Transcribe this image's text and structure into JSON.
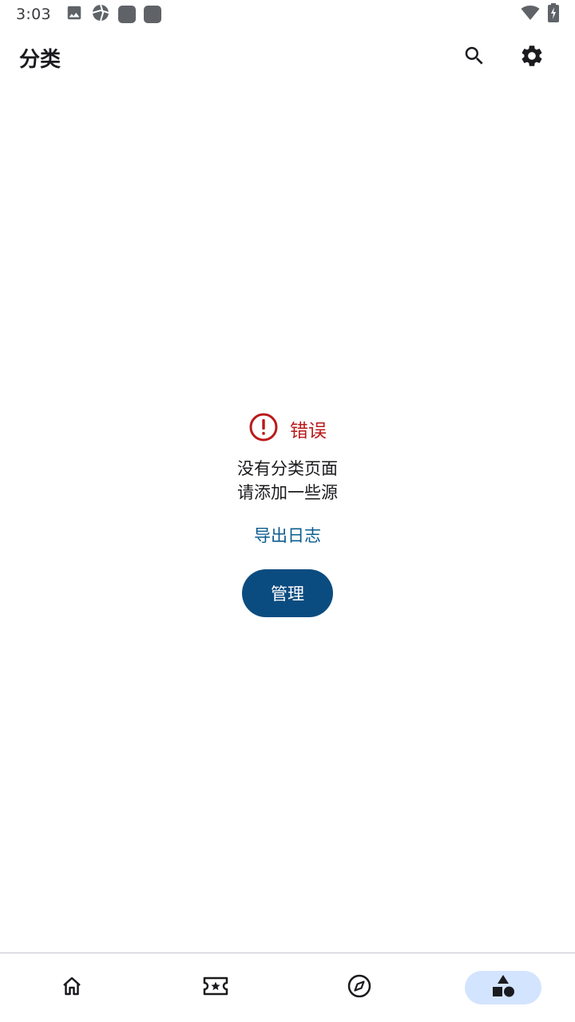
{
  "status_bar": {
    "time": "3:03",
    "left_icons": [
      "image-icon",
      "sync-icon",
      "app-notification-icon",
      "app-notification-icon"
    ],
    "right_icons": [
      "wifi-icon",
      "battery-charging-icon"
    ]
  },
  "app_bar": {
    "title": "分类",
    "actions": [
      "search-icon",
      "settings-icon"
    ]
  },
  "empty_state": {
    "error_label": "错误",
    "message_line1": "没有分类页面",
    "message_line2": "请添加一些源",
    "export_logs_label": "导出日志",
    "manage_label": "管理"
  },
  "bottom_nav": {
    "items": [
      {
        "icon": "home-icon",
        "active": false
      },
      {
        "icon": "ticket-star-icon",
        "active": false
      },
      {
        "icon": "compass-icon",
        "active": false
      },
      {
        "icon": "category-shapes-icon",
        "active": true
      }
    ]
  },
  "colors": {
    "error": "#ba1a1a",
    "primary": "#0b4c80",
    "link": "#0b5c8f",
    "nav_active_pill": "#d3e4ff"
  }
}
